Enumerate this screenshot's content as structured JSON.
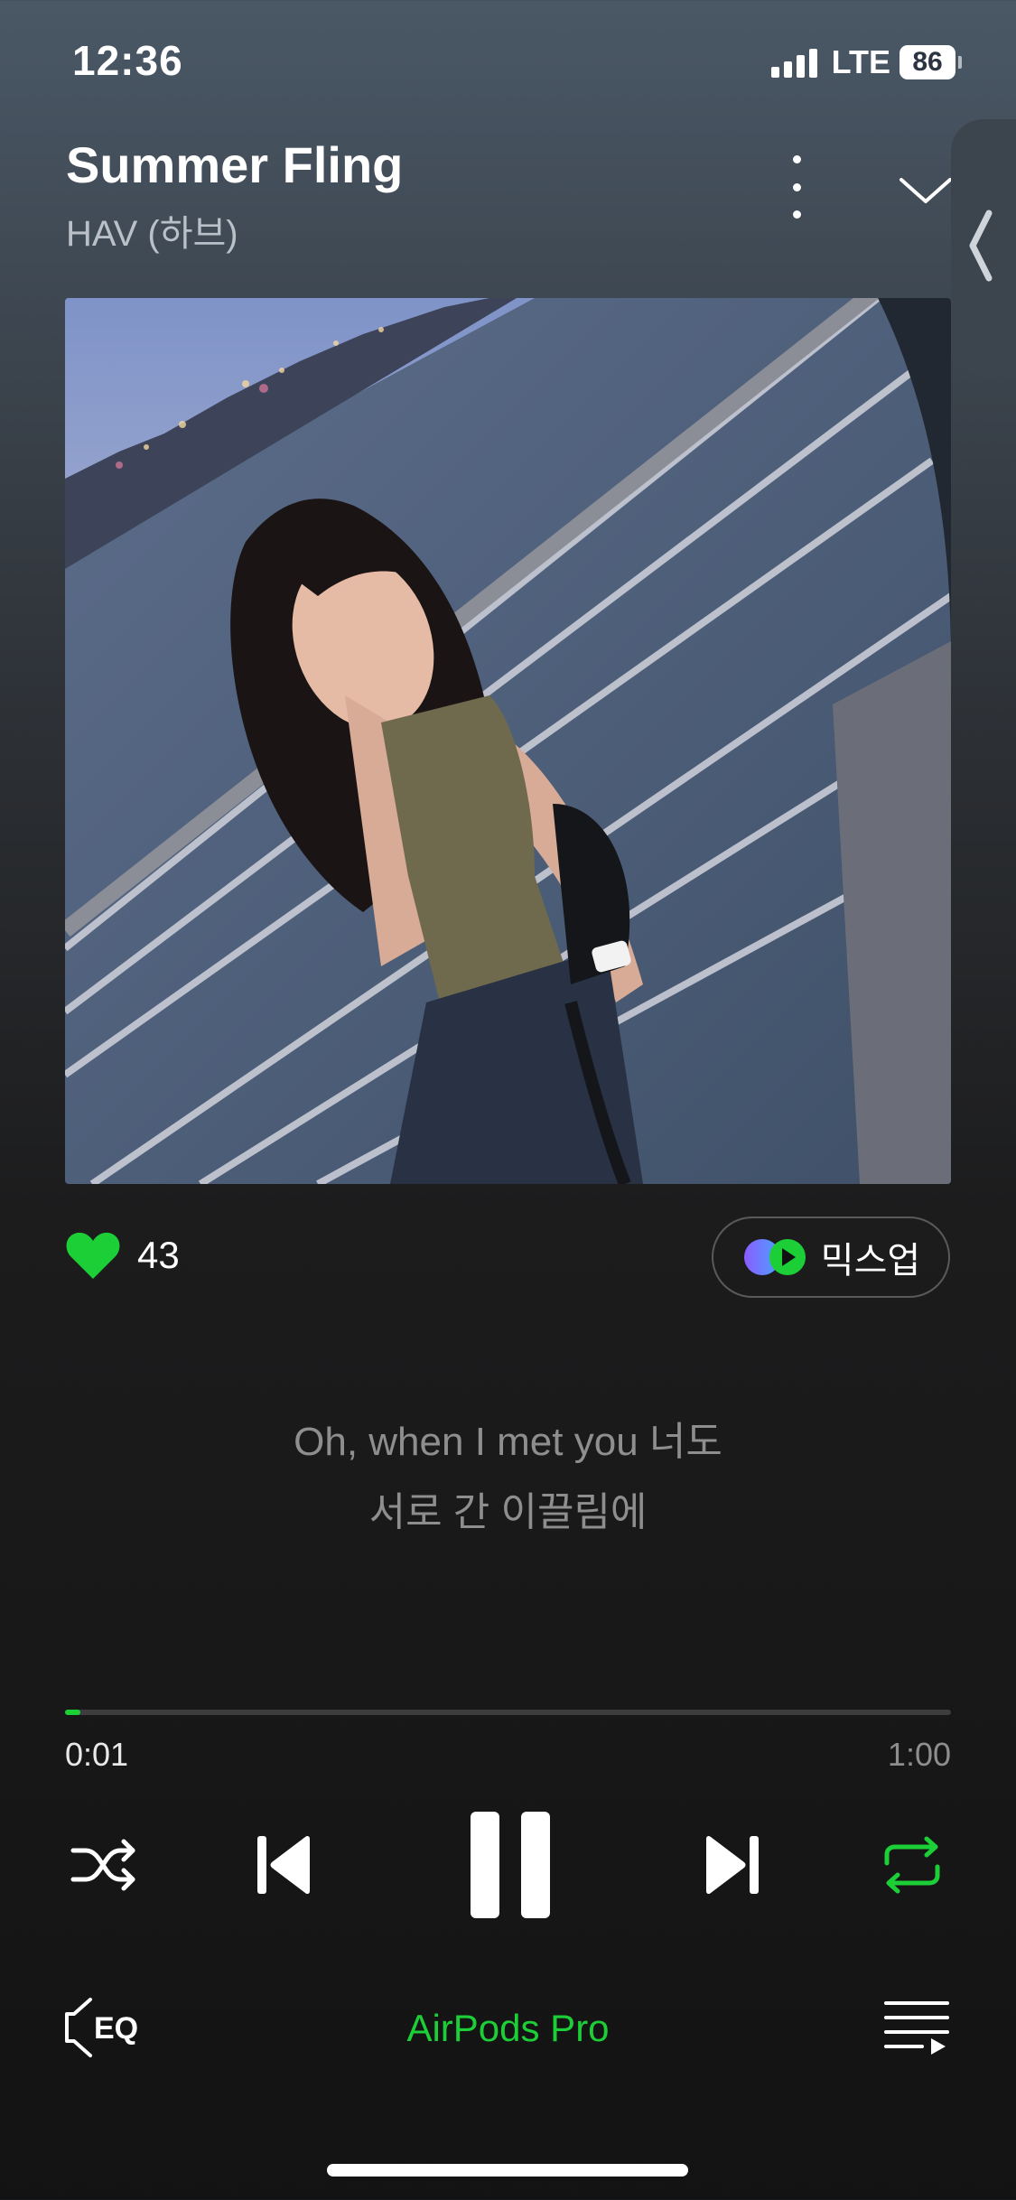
{
  "status": {
    "time": "12:36",
    "network": "LTE",
    "battery": "86"
  },
  "track": {
    "title": "Summer Fling",
    "artist": "HAV (하브)"
  },
  "likes": {
    "count": "43",
    "liked": true
  },
  "mixup": {
    "label": "믹스업"
  },
  "lyrics": [
    "Oh, when I met you 너도",
    "서로 간 이끌림에"
  ],
  "progress": {
    "current": "0:01",
    "total": "1:00",
    "fraction": 0.017
  },
  "controls": {
    "shuffle": "shuffle-icon",
    "prev": "previous-icon",
    "play_state": "pause-icon",
    "next": "next-icon",
    "repeat": "repeat-icon",
    "repeat_active": true
  },
  "bottom": {
    "eq_label": "EQ",
    "device": "AirPods Pro"
  },
  "colors": {
    "accent": "#1ccf36",
    "background": "#131313",
    "muted_text": "#8e8e8e"
  }
}
